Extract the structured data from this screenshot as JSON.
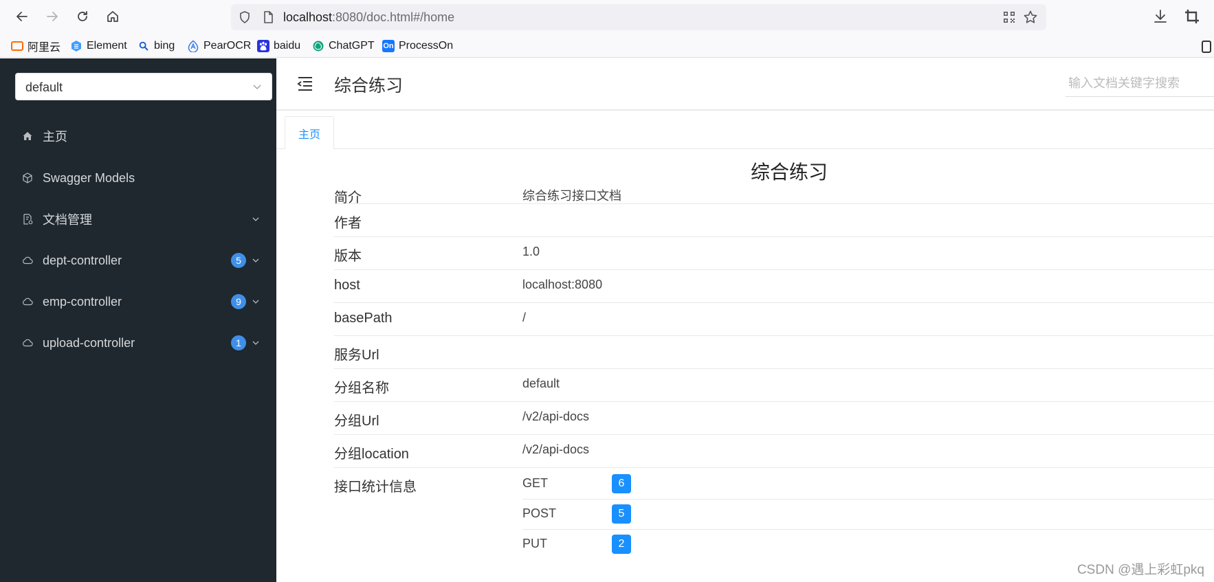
{
  "browser": {
    "url_host": "localhost",
    "url_rest": ":8080/doc.html#/home",
    "bookmarks": [
      {
        "label": "阿里云",
        "icon": "aliyun-icon",
        "color": "#ff6a00"
      },
      {
        "label": "Element",
        "icon": "element-icon",
        "color": "#409eff"
      },
      {
        "label": "bing",
        "icon": "search-icon",
        "color": "#1b5fd1"
      },
      {
        "label": "PearOCR",
        "icon": "pearocr-icon",
        "color": "#3a7be0"
      },
      {
        "label": "baidu",
        "icon": "baidu-icon",
        "color": "#2932e1"
      },
      {
        "label": "ChatGPT",
        "icon": "chatgpt-icon",
        "color": "#10a37f"
      },
      {
        "label": "ProcessOn",
        "icon": "processon-icon",
        "color": "#1677ff",
        "icon_text": "On"
      }
    ]
  },
  "sidebar": {
    "group_value": "default",
    "items": [
      {
        "label": "主页",
        "icon": "home-icon"
      },
      {
        "label": "Swagger Models",
        "icon": "cube-icon"
      },
      {
        "label": "文档管理",
        "icon": "doc-settings-icon"
      },
      {
        "label": "dept-controller",
        "icon": "cloud-icon",
        "badge": "5"
      },
      {
        "label": "emp-controller",
        "icon": "cloud-icon",
        "badge": "9"
      },
      {
        "label": "upload-controller",
        "icon": "cloud-icon",
        "badge": "1"
      }
    ]
  },
  "header": {
    "title": "综合练习",
    "search_placeholder": "输入文档关键字搜索"
  },
  "tabs": [
    {
      "label": "主页"
    }
  ],
  "doc": {
    "title": "综合练习",
    "rows": [
      {
        "key": "简介",
        "value": "综合练习接口文档"
      },
      {
        "key": "作者",
        "value": ""
      },
      {
        "key": "版本",
        "value": "1.0"
      },
      {
        "key": "host",
        "value": "localhost:8080"
      },
      {
        "key": "basePath",
        "value": "/"
      },
      {
        "key": "服务Url",
        "value": ""
      },
      {
        "key": "分组名称",
        "value": "default"
      },
      {
        "key": "分组Url",
        "value": "/v2/api-docs"
      },
      {
        "key": "分组location",
        "value": "/v2/api-docs"
      }
    ],
    "stats_label": "接口统计信息",
    "stats": [
      {
        "method": "GET",
        "count": "6"
      },
      {
        "method": "POST",
        "count": "5"
      },
      {
        "method": "PUT",
        "count": "2"
      }
    ]
  },
  "watermark": "CSDN @遇上彩虹pkq"
}
